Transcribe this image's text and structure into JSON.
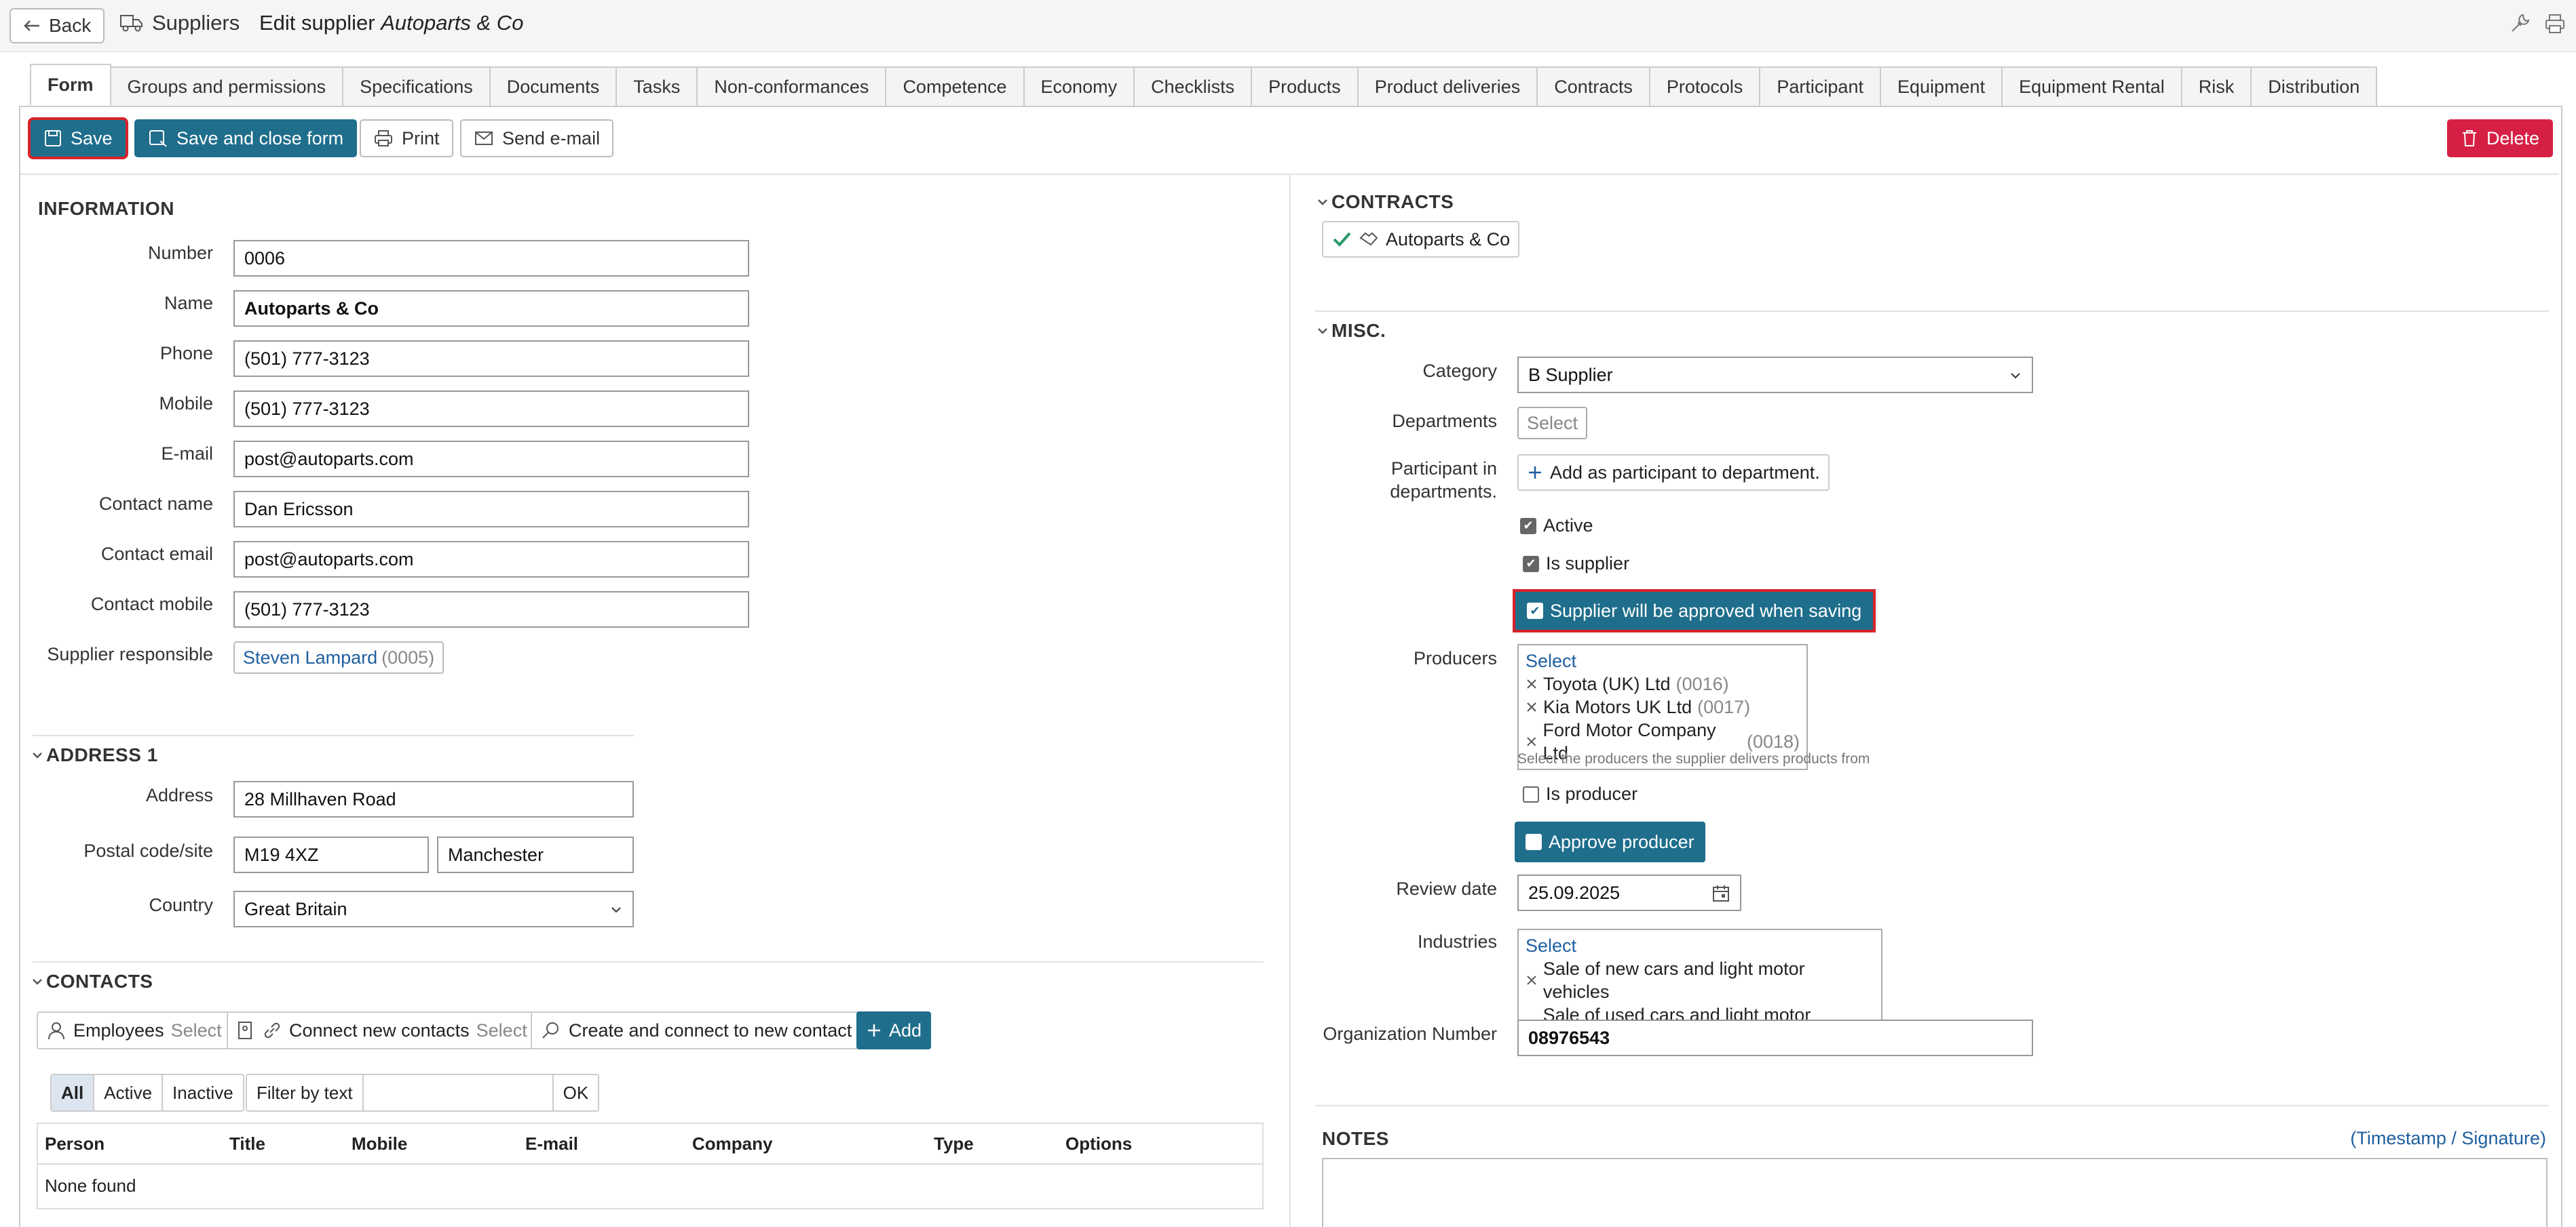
{
  "topbar": {
    "back_label": "Back",
    "breadcrumb": "Suppliers",
    "title_prefix": "Edit supplier ",
    "title_name": "Autoparts & Co"
  },
  "tabs": [
    "Form",
    "Groups and permissions",
    "Specifications",
    "Documents",
    "Tasks",
    "Non-conformances",
    "Competence",
    "Economy",
    "Checklists",
    "Products",
    "Product deliveries",
    "Contracts",
    "Protocols",
    "Participant",
    "Equipment",
    "Equipment Rental",
    "Risk",
    "Distribution"
  ],
  "toolbar": {
    "save": "Save",
    "save_close": "Save and close form",
    "print": "Print",
    "send_email": "Send e-mail",
    "delete": "Delete"
  },
  "information": {
    "heading": "INFORMATION",
    "fields": [
      {
        "label": "Number",
        "value": "0006"
      },
      {
        "label": "Name",
        "value": "Autoparts & Co"
      },
      {
        "label": "Phone",
        "value": "(501) 777-3123"
      },
      {
        "label": "Mobile",
        "value": "(501) 777-3123"
      },
      {
        "label": "E-mail",
        "value": "post@autoparts.com"
      },
      {
        "label": "Contact name",
        "value": "Dan Ericsson"
      },
      {
        "label": "Contact email",
        "value": "post@autoparts.com"
      },
      {
        "label": "Contact mobile",
        "value": "(501) 777-3123"
      }
    ],
    "responsible_label": "Supplier responsible",
    "responsible_name": "Steven Lampard",
    "responsible_code": "(0005)"
  },
  "address": {
    "heading": "ADDRESS 1",
    "address_label": "Address",
    "address_value": "28 Millhaven Road",
    "postal_label": "Postal code/site",
    "postal_value": "M19 4XZ",
    "site_value": "Manchester",
    "country_label": "Country",
    "country_value": "Great Britain"
  },
  "contacts": {
    "heading": "CONTACTS",
    "employees": "Employees",
    "select": "Select",
    "connect_new": "Connect new contacts",
    "create_connect": "Create and connect to new contact",
    "add": "Add",
    "filters": [
      "All",
      "Active",
      "Inactive"
    ],
    "filter_text": "Filter by text",
    "ok": "OK",
    "columns": [
      "Person",
      "Title",
      "Mobile",
      "E-mail",
      "Company",
      "Type",
      "Options"
    ],
    "empty": "None found"
  },
  "contracts": {
    "heading": "CONTRACTS",
    "item": "Autoparts & Co"
  },
  "misc": {
    "heading": "MISC.",
    "category_label": "Category",
    "category_value": "B Supplier",
    "departments_label": "Departments",
    "departments_select": "Select",
    "participant_label_1": "Participant in",
    "participant_label_2": "departments.",
    "add_participant": "Add as participant to department.",
    "active": "Active",
    "is_supplier": "Is supplier",
    "approve_supplier": "Supplier will be approved when saving",
    "producers_label": "Producers",
    "producers_select": "Select",
    "producers": [
      {
        "name": "Toyota (UK) Ltd",
        "code": "(0016)"
      },
      {
        "name": "Kia Motors UK Ltd",
        "code": "(0017)"
      },
      {
        "name": "Ford Motor Company Ltd",
        "code": "(0018)"
      }
    ],
    "producers_hint": "Select the producers the supplier delivers products from",
    "is_producer": "Is producer",
    "approve_producer": "Approve producer",
    "review_label": "Review date",
    "review_value": "25.09.2025",
    "industries_label": "Industries",
    "industries_select": "Select",
    "industries": [
      "Sale of new cars and light motor vehicles",
      "Sale of used cars and light motor vehicles"
    ],
    "org_label": "Organization Number",
    "org_value": "08976543"
  },
  "notes": {
    "heading": "NOTES",
    "timestamp": "(Timestamp / Signature)"
  }
}
